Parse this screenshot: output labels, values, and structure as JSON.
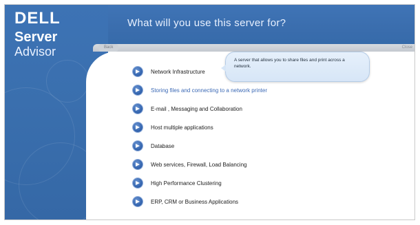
{
  "brand": {
    "logo_text": "DELL",
    "product_line1": "Server",
    "product_line2": "Advisor"
  },
  "header": {
    "question": "What will you use this server for?"
  },
  "navbar": {
    "back_label": "Back",
    "close_label": "Close"
  },
  "options": [
    {
      "label": "Network Infrastructure",
      "active": false
    },
    {
      "label": "Storing files and connecting to a network printer",
      "active": true
    },
    {
      "label": "E-mail , Messaging and Collaboration",
      "active": false
    },
    {
      "label": "Host multiple applications",
      "active": false
    },
    {
      "label": "Database",
      "active": false
    },
    {
      "label": "Web services, Firewall, Load Balancing",
      "active": false
    },
    {
      "label": "High Performance Clustering",
      "active": false
    },
    {
      "label": "ERP, CRM or Business Applications",
      "active": false
    }
  ],
  "tooltip": {
    "text": "A server that allows you to share files and print across a network."
  },
  "colors": {
    "brand_blue": "#3a6fae",
    "active_option_text": "#3b69b5",
    "option_icon": "#3566b0"
  }
}
